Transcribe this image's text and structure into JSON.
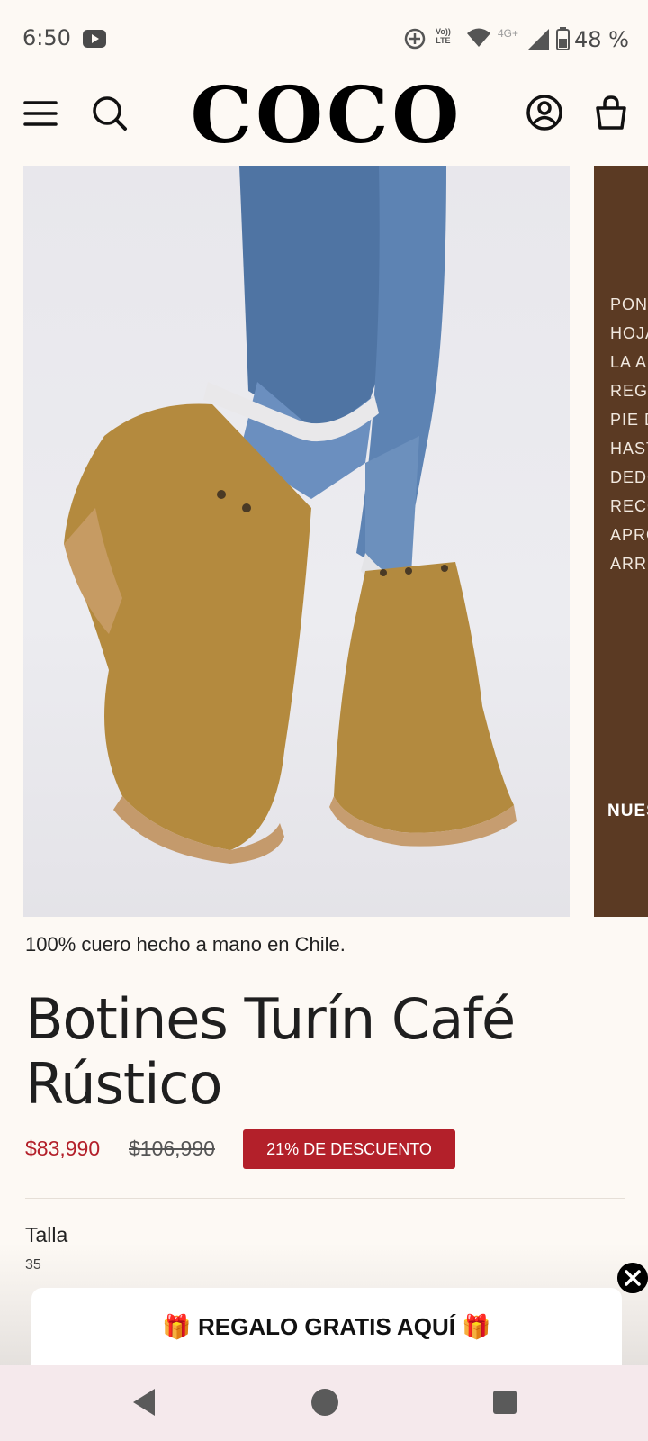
{
  "status_bar": {
    "time": "6:50",
    "network_label": "4G+",
    "battery": "48 %",
    "icons": [
      "youtube-icon",
      "sync-icon",
      "volte-icon",
      "wifi-icon",
      "signal-icon",
      "battery-icon"
    ]
  },
  "header": {
    "logo": "COCO",
    "icons": [
      "menu-icon",
      "search-icon",
      "account-icon",
      "cart-icon"
    ]
  },
  "gallery": {
    "next_slide_lines": [
      "PON",
      "HOJA",
      "LA A",
      "REGI",
      "PIE D",
      "HAST",
      "DEDO",
      "RECO",
      "APRO",
      "ARRI"
    ],
    "next_slide_bottom": "NUES"
  },
  "product": {
    "tagline": "100% cuero hecho a mano en Chile.",
    "title": "Botines Turín Café Rústico",
    "price_sale": "$83,990",
    "price_original": "$106,990",
    "discount_badge": "21% DE DESCUENTO",
    "size_label": "Talla",
    "size_value": "35"
  },
  "promo": {
    "text": "🎁 REGALO GRATIS AQUÍ 🎁"
  },
  "colors": {
    "accent": "#b3202a",
    "background": "#fdf9f4",
    "slide_brown": "#5b3a23"
  }
}
